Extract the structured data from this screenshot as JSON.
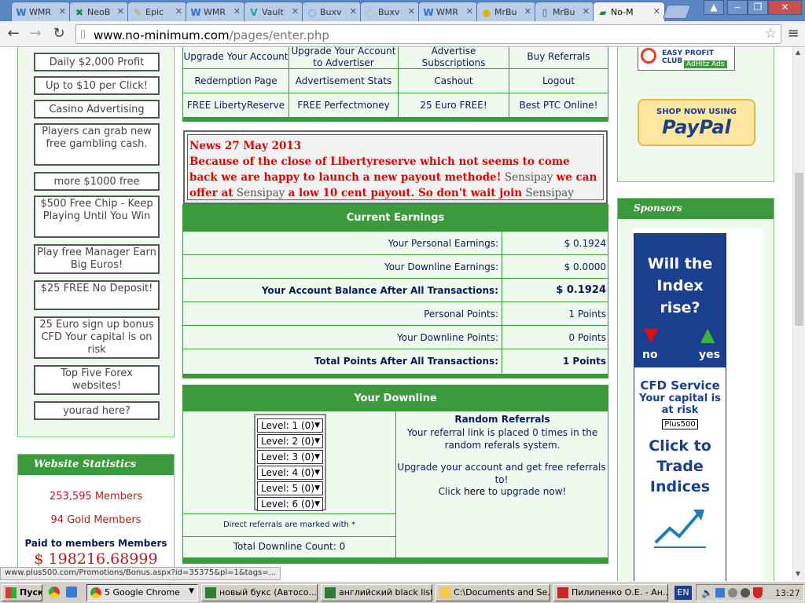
{
  "browser": {
    "tabs": [
      {
        "label": "WMR",
        "icon": "w-icon"
      },
      {
        "label": "NeoB",
        "icon": "x-icon"
      },
      {
        "label": "Epic",
        "icon": "feather-icon"
      },
      {
        "label": "WMR",
        "icon": "w-icon"
      },
      {
        "label": "Vault",
        "icon": "v-icon"
      },
      {
        "label": "Buxv",
        "icon": "swirl-icon"
      },
      {
        "label": "Buxv",
        "icon": "swirl-icon"
      },
      {
        "label": "WMR",
        "icon": "w-icon"
      },
      {
        "label": "MrBu",
        "icon": "coin-icon"
      },
      {
        "label": "MrBu",
        "icon": "page-icon"
      },
      {
        "label": "No-M",
        "icon": "site-icon",
        "active": true
      }
    ],
    "url_host": "www.no-minimum.com",
    "url_path": "/pages/enter.php"
  },
  "left_ads": [
    "Daily $2,000 Profit",
    "Up to $10 per Click!",
    "Casino Advertising",
    "Players can grab new free gambling cash.",
    "more $1000 free",
    "$500 Free Chip - Keep Playing Until You Win",
    "Play free Manager Earn Big Euros!",
    "$25 FREE No Deposit!",
    "25 Euro sign up bonus CFD Your capital is on risk",
    "Top Five Forex websites!",
    "yourad here?"
  ],
  "stats": {
    "header": "Website Statistics",
    "members": "253,595 Members",
    "gold": "94 Gold Members",
    "paid_label": "Paid to members Members",
    "paid_value": "$ 198216.68999"
  },
  "menu": [
    [
      "Upgrade Your Account",
      "Upgrade Your Account to Advertiser",
      "Advertise Subscriptions",
      "Buy Referrals"
    ],
    [
      "Redemption Page",
      "Advertisement Stats",
      "Cashout",
      "Logout"
    ],
    [
      "FREE LibertyReserve",
      "FREE Perfectmoney",
      "25 Euro FREE!",
      "Best PTC Online!"
    ]
  ],
  "news": {
    "date": "News 27 May 2013",
    "p1": "Because of the close of Libertyreserve which not seems to come back we are happy to launch a new payout methode!",
    "g1": "Sensipay",
    "p2": "we can offer at",
    "g2": "Sensipay",
    "p3": "a low 10 cent payout. So don't wait join",
    "g3": "Sensipay today by click here!"
  },
  "earnings": {
    "header": "Current Earnings",
    "rows": [
      {
        "label": "Your Personal Earnings:",
        "value": "$  0.1924",
        "bold": false
      },
      {
        "label": "Your Downline Earnings:",
        "value": "$  0.0000",
        "bold": false
      },
      {
        "label": "Your Account Balance After All Transactions:",
        "value": "$  0.1924",
        "bold": true
      },
      {
        "label": "Personal Points:",
        "value": "1 Points",
        "bold": false
      },
      {
        "label": "Your Downline Points:",
        "value": "0 Points",
        "bold": false
      },
      {
        "label": "Total Points After All Transactions:",
        "value": "1 Points",
        "bold": true
      }
    ]
  },
  "downline": {
    "header": "Your Downline",
    "levels": [
      "Level: 1 (0)",
      "Level: 2 (0)",
      "Level: 3 (0)",
      "Level: 4 (0)",
      "Level: 5 (0)",
      "Level: 6 (0)"
    ],
    "direct_note": "Direct referrals are marked with *",
    "total": "Total Downline Count:  0",
    "random_title": "Random Referrals",
    "random_text": "Your referral link is placed 0 times in the random referals system.",
    "upgrade_text": "Upgrade your account and get free referrals to!",
    "click": "Click",
    "here": "here",
    "upgrade_now": "to upgrade now!"
  },
  "right": {
    "epc_name": "EASY PROFIT CLUB",
    "adhitz": "AdHitz Ads",
    "paypal_top": "SHOP NOW USING",
    "paypal_logo": "PayPal",
    "sponsors_header": "Sponsors",
    "ad_headline": "Will the Index rise?",
    "ad_no": "no",
    "ad_yes": "yes",
    "ad_cfd": "CFD Service",
    "ad_risk": "Your capital is at risk",
    "ad_brand": "Plus500",
    "ad_cta": "Click to Trade Indices"
  },
  "status_url": "www.plus500.com/Promotions/Bonus.aspx?id=35375&pl=1&tags=...",
  "taskbar": {
    "start": "Пуск",
    "buttons": [
      "5 Google Chrome",
      "новый букс (Автосо...",
      "английский black list",
      "C:\\Documents and Se...",
      "Пилипенко О.Е. - Ан..."
    ],
    "lang": "EN",
    "clock": "13:27"
  },
  "colors": {
    "accent_green": "#3c9a3c",
    "link_navy": "#0a1a55",
    "news_red": "#e00000"
  }
}
